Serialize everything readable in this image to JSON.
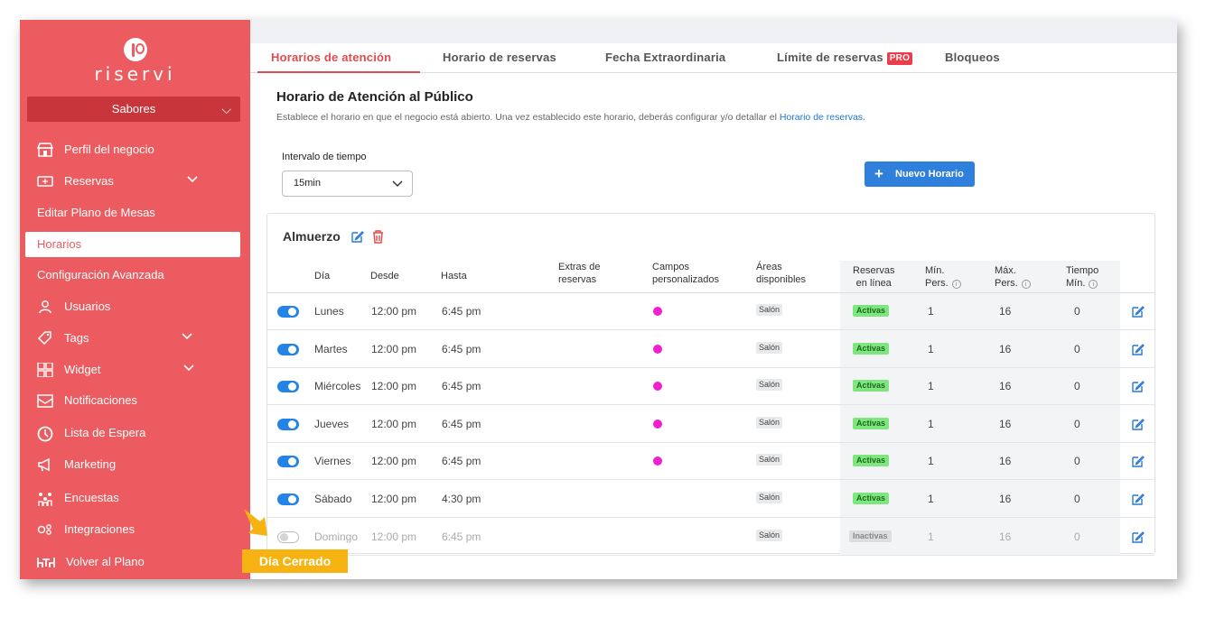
{
  "brand": {
    "name": "riservi"
  },
  "sidebar": {
    "business_select": "Sabores",
    "items": [
      {
        "label": "Perfil del negocio",
        "icon": "store-icon"
      },
      {
        "label": "Reservas",
        "icon": "ticket-icon",
        "expandable": true
      },
      {
        "label": "Editar Plano de Mesas"
      },
      {
        "label": "Horarios",
        "active": true
      },
      {
        "label": "Configuración Avanzada"
      },
      {
        "label": "Usuarios",
        "icon": "user-icon"
      },
      {
        "label": "Tags",
        "icon": "tag-icon",
        "expandable": true
      },
      {
        "label": "Widget",
        "icon": "grid-icon",
        "expandable": true
      },
      {
        "label": "Notificaciones",
        "icon": "mail-icon"
      },
      {
        "label": "Lista de Espera",
        "icon": "clock-icon"
      },
      {
        "label": "Marketing",
        "icon": "megaphone-icon"
      },
      {
        "label": "Encuestas",
        "icon": "survey-icon"
      },
      {
        "label": "Integraciones",
        "icon": "integrations-icon"
      },
      {
        "label": "Volver al Plano",
        "icon": "tables-icon"
      }
    ]
  },
  "tabs": [
    {
      "label": "Horarios de atención",
      "active": true
    },
    {
      "label": "Horario de reservas"
    },
    {
      "label": "Fecha Extraordinaria"
    },
    {
      "label": "Límite de reservas",
      "badge": "PRO"
    },
    {
      "label": "Bloqueos"
    }
  ],
  "page": {
    "title": "Horario de Atención al Público",
    "description": "Establece el horario en que el negocio está abierto. Una vez establecido este horario, deberás configurar y/o detallar el",
    "description_link": "Horario de reservas",
    "description_end": "."
  },
  "interval": {
    "label": "Intervalo de tiempo",
    "value": "15min"
  },
  "new_button": {
    "label": "Nuevo Horario"
  },
  "schedule": {
    "title": "Almuerzo",
    "columns": {
      "day": "Día",
      "from": "Desde",
      "to": "Hasta",
      "extras_1": "Extras de",
      "extras_2": "reservas",
      "fields_1": "Campos",
      "fields_2": "personalizados",
      "areas_1": "Áreas",
      "areas_2": "disponibles",
      "online_1": "Reservas",
      "online_2": "en línea",
      "min_1": "Mín.",
      "min_2": "Pers.",
      "max_1": "Máx.",
      "max_2": "Pers.",
      "time_1": "Tiempo",
      "time_2": "Mín."
    },
    "rows": [
      {
        "enabled": true,
        "day": "Lunes",
        "from": "12:00 pm",
        "to": "6:45 pm",
        "has_fields": true,
        "area": "Salón",
        "status": "Activas",
        "min": "1",
        "max": "16",
        "time": "0"
      },
      {
        "enabled": true,
        "day": "Martes",
        "from": "12:00 pm",
        "to": "6:45 pm",
        "has_fields": true,
        "area": "Salón",
        "status": "Activas",
        "min": "1",
        "max": "16",
        "time": "0"
      },
      {
        "enabled": true,
        "day": "Miércoles",
        "from": "12:00 pm",
        "to": "6:45 pm",
        "has_fields": true,
        "area": "Salón",
        "status": "Activas",
        "min": "1",
        "max": "16",
        "time": "0"
      },
      {
        "enabled": true,
        "day": "Jueves",
        "from": "12:00 pm",
        "to": "6:45 pm",
        "has_fields": true,
        "area": "Salón",
        "status": "Activas",
        "min": "1",
        "max": "16",
        "time": "0"
      },
      {
        "enabled": true,
        "day": "Viernes",
        "from": "12:00 pm",
        "to": "6:45 pm",
        "has_fields": true,
        "area": "Salón",
        "status": "Activas",
        "min": "1",
        "max": "16",
        "time": "0"
      },
      {
        "enabled": true,
        "day": "Sábado",
        "from": "12:00 pm",
        "to": "4:30 pm",
        "has_fields": false,
        "area": "Salón",
        "status": "Activas",
        "min": "1",
        "max": "16",
        "time": "0"
      },
      {
        "enabled": false,
        "day": "Domingo",
        "from": "12:00 pm",
        "to": "6:45 pm",
        "has_fields": false,
        "area": "Salón",
        "status": "Inactivas",
        "min": "1",
        "max": "16",
        "time": "0"
      }
    ]
  },
  "callout": {
    "label": "Día Cerrado"
  },
  "colors": {
    "brand": "#ec5b5f",
    "accent_blue": "#2f7fdc",
    "callout": "#f6b312",
    "field_dot": "#f01fd0",
    "active_badge": "#7fe57f"
  }
}
